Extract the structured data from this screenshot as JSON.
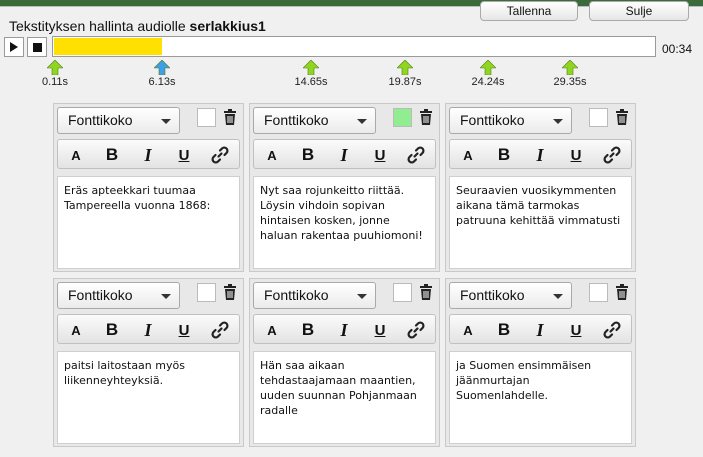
{
  "header": {
    "title_prefix": "Tekstityksen hallinta audiolle",
    "title_name": "serlakkius1",
    "save_label": "Tallenna",
    "close_label": "Sulje"
  },
  "player": {
    "duration": "00:34",
    "progress_fraction": 0.18
  },
  "markers": [
    {
      "label": "0.11s",
      "color": "#8ed61f"
    },
    {
      "label": "6.13s",
      "color": "#3ca0e6"
    },
    {
      "label": "14.65s",
      "color": "#8ed61f"
    },
    {
      "label": "19.87s",
      "color": "#8ed61f"
    },
    {
      "label": "24.24s",
      "color": "#8ed61f"
    },
    {
      "label": "29.35s",
      "color": "#8ed61f"
    }
  ],
  "font_select_label": "Fonttikoko",
  "toolbar": {
    "a": "A",
    "b": "B",
    "i": "I",
    "u": "U"
  },
  "cards": [
    {
      "text": "Eräs apteekkari tuumaa Tampereella vuonna 1868:",
      "swatch": "#ffffff"
    },
    {
      "text": "Nyt saa rojunkeitto riittää. Löysin vihdoin sopivan hintaisen kosken, jonne haluan rakentaa puuhiomoni!",
      "swatch": "#90ee90"
    },
    {
      "text": "Seuraavien vuosikymmenten aikana tämä tarmokas patruuna kehittää vimmatusti",
      "swatch": "#ffffff"
    },
    {
      "text": "paitsi laitostaan myös liikenneyhteyksiä.",
      "swatch": "#ffffff"
    },
    {
      "text": "Hän saa aikaan tehdastaajamaan maantien, uuden suunnan Pohjanmaan radalle",
      "swatch": "#ffffff"
    },
    {
      "text": "ja Suomen ensimmäisen jäänmurtajan Suomenlahdelle.",
      "swatch": "#ffffff"
    }
  ]
}
